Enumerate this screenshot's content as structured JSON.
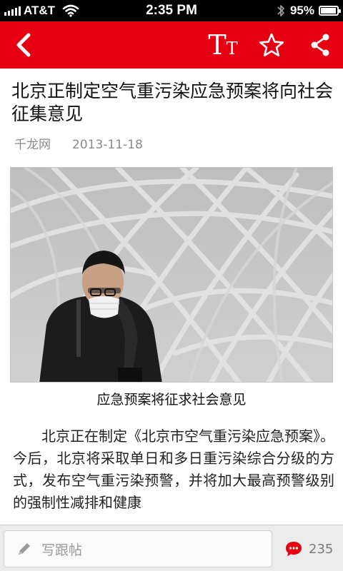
{
  "status_bar": {
    "carrier": "AT&T",
    "time": "2:35 PM",
    "battery_percent": "95%",
    "battery_level": 0.95,
    "icons": [
      "signal-bars-icon",
      "wifi-icon",
      "bluetooth-icon",
      "battery-icon"
    ]
  },
  "toolbar": {
    "background": "#e60012",
    "font_size_label_big": "T",
    "font_size_label_small": "T",
    "icons": [
      "back-chevron-icon",
      "font-size-icon",
      "star-icon",
      "share-icon"
    ]
  },
  "article": {
    "title": "北京正制定空气重污染应急预案将向社会征集意见",
    "source": "千龙网",
    "date": "2013-11-18",
    "image_caption": "应急预案将征求社会意见",
    "body": "北京正在制定《北京市空气重污染应急预案》。今后，北京将采取单日和多日重污染综合分级的方式，发布空气重污染预警，并将加大最高预警级别的强制性减排和健康"
  },
  "bottom_bar": {
    "comment_placeholder": "写跟帖",
    "comment_count": "235",
    "icons": [
      "pencil-icon",
      "comment-bubble-icon"
    ]
  }
}
